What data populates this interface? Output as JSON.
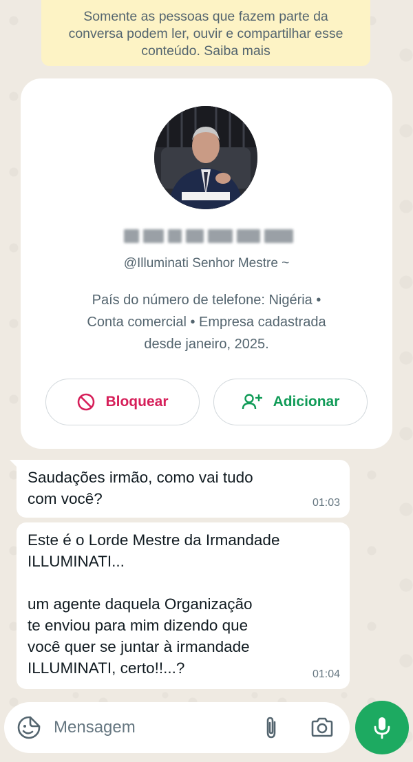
{
  "encryption_notice": {
    "text": "Somente as pessoas que fazem parte da conversa podem ler, ouvir e compartilhar esse conteúdo. Saiba mais"
  },
  "profile": {
    "username": "@Illuminati Senhor Mestre ~",
    "info_line_1": "País do número de telefone: Nigéria •",
    "info_line_2": "Conta comercial • Empresa cadastrada",
    "info_line_3": "desde janeiro, 2025.",
    "block_label": "Bloquear",
    "add_label": "Adicionar"
  },
  "messages": [
    {
      "text": "Saudações irmão, como vai tudo\ncom você?",
      "time": "01:03"
    },
    {
      "text": "Este é o Lorde Mestre da Irmandade\nILLUMINATI...\n\num agente daquela Organização\nte enviou para mim dizendo que\nvocê quer se juntar à irmandade\nILLUMINATI, certo!!...?",
      "time": "01:04"
    }
  ],
  "input": {
    "placeholder": "Mensagem"
  },
  "icons": {
    "emoji": "sticker-emoji-icon",
    "attach": "paperclip-icon",
    "camera": "camera-icon",
    "mic": "microphone-icon",
    "block": "block-icon",
    "add": "add-contact-icon"
  },
  "colors": {
    "block": "#d6205a",
    "add": "#109b57",
    "mic_button": "#1daa61",
    "notice_bg": "#fdf3c5"
  }
}
